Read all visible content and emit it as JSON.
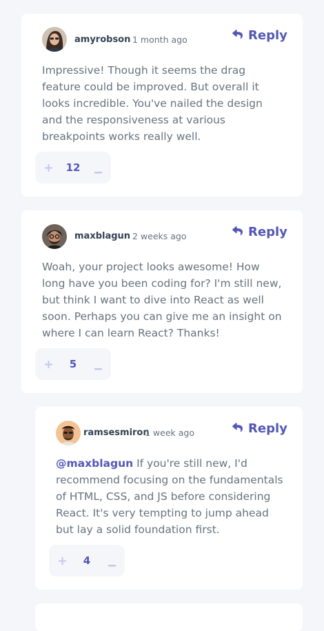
{
  "comments": [
    {
      "username": "amyrobson",
      "date": "1 month ago",
      "reply_label": "Reply",
      "content": "Impressive! Though it seems the drag feature could be improved. But overall it looks incredible. You've nailed the design and the responsiveness at various breakpoints works really well.",
      "score": "12"
    },
    {
      "username": "maxblagun",
      "date": "2 weeks ago",
      "reply_label": "Reply",
      "content": "Woah, your project looks awesome! How long have you been coding for? I'm still new, but think I want to dive into React as well soon. Perhaps you can give me an insight on where I can learn React? Thanks!",
      "score": "5"
    }
  ],
  "replies": [
    {
      "username": "ramsesmiron",
      "date": "1 week ago",
      "reply_label": "Reply",
      "mention": "@maxblagun",
      "content": " If you're still new, I'd recommend focusing on the fundamentals of HTML, CSS, and JS before considering React. It's very tempting to jump ahead but lay a solid foundation first.",
      "score": "4"
    }
  ],
  "vote_controls": {
    "plus_icon": "plus-icon",
    "minus_icon": "minus-icon"
  },
  "reply_icon": "reply-arrow-icon",
  "colors": {
    "background": "#f5f6fa",
    "card": "#ffffff",
    "accent": "#5357b6",
    "accent_light": "#c5c6ef",
    "username": "#334253",
    "body_text": "#67727e"
  }
}
